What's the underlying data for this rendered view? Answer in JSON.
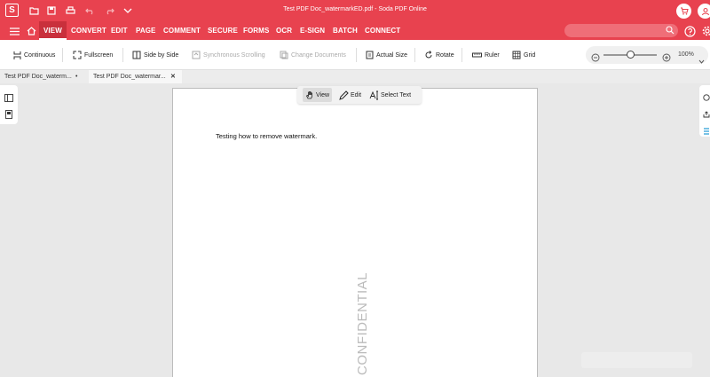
{
  "app": {
    "logo_letter": "S",
    "window_title": "Test PDF Doc_watermarkED.pdf - Soda PDF Online"
  },
  "menu": {
    "items": [
      "VIEW",
      "CONVERT",
      "EDIT",
      "PAGE",
      "COMMENT",
      "SECURE",
      "FORMS",
      "OCR",
      "E-SIGN",
      "BATCH",
      "CONNECT"
    ],
    "active": "VIEW"
  },
  "toolbar": {
    "continuous": "Continuous",
    "fullscreen": "Fullscreen",
    "side_by_side": "Side by Side",
    "sync_scrolling": "Synchronous Scrolling",
    "change_documents": "Change Documents",
    "actual_size": "Actual Size",
    "rotate": "Rotate",
    "ruler": "Ruler",
    "grid": "Grid",
    "zoom": "100%",
    "zoom_level": 0.5
  },
  "tabs": [
    {
      "label": "Test PDF Doc_waterm...",
      "close": "•"
    },
    {
      "label": "Test PDF Doc_watermar...",
      "close": "✕"
    }
  ],
  "mode": {
    "view": "View",
    "edit": "Edit",
    "select_text": "Select Text"
  },
  "document": {
    "body_text": "Testing how to remove watermark.",
    "watermark": "CONFIDENTIAL"
  },
  "colors": {
    "brand": "#e8424f",
    "brand_dark": "#c9303c"
  },
  "icons": [
    "menu-icon",
    "home-icon",
    "open-folder-icon",
    "save-icon",
    "print-icon",
    "undo-icon",
    "redo-icon",
    "chevron-down-icon",
    "cart-icon",
    "account-icon",
    "help-icon",
    "settings-icon",
    "search-icon",
    "hand-icon",
    "pencil-icon",
    "select-text-icon"
  ]
}
